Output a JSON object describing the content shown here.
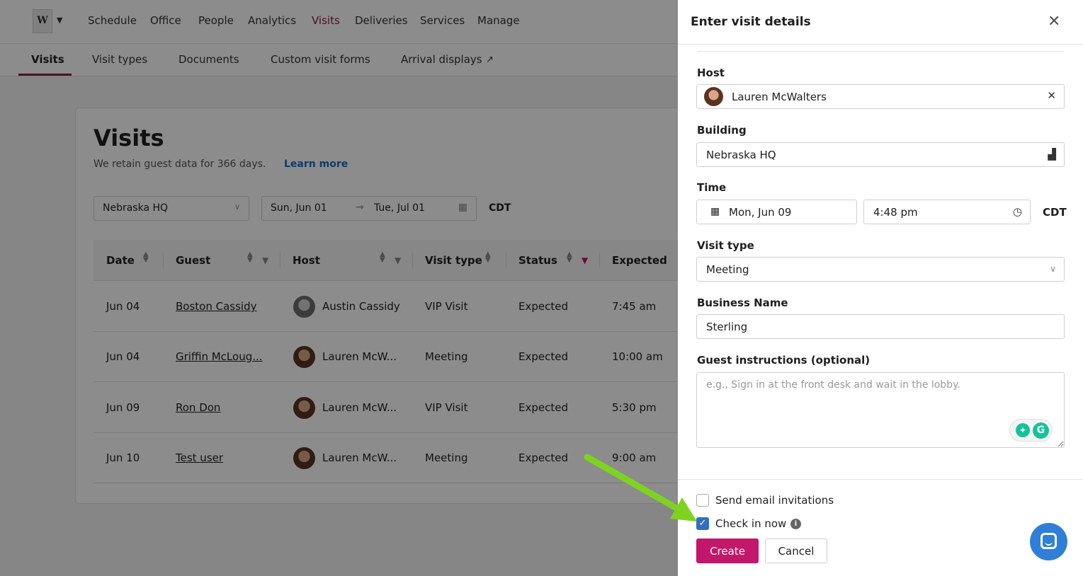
{
  "logo": {
    "letter": "W"
  },
  "nav": {
    "items": [
      "Schedule",
      "Office",
      "People",
      "Analytics",
      "Visits",
      "Deliveries",
      "Services",
      "Manage"
    ],
    "active": "Visits"
  },
  "subnav": {
    "items": [
      "Visits",
      "Visit types",
      "Documents",
      "Custom visit forms",
      "Arrival displays"
    ],
    "active": "Visits"
  },
  "visits": {
    "title": "Visits",
    "retain_text": "We retain guest data for 366 days.",
    "learn_more": "Learn more",
    "building_filter": "Nebraska HQ",
    "date_from": "Sun, Jun 01",
    "date_to": "Tue, Jul 01",
    "timezone": "CDT",
    "columns": [
      "Date",
      "Guest",
      "Host",
      "Visit type",
      "Status",
      "Expected"
    ],
    "rows": [
      {
        "date": "Jun 04",
        "guest": "Boston Cassidy",
        "host": "Austin Cassidy",
        "visit_type": "VIP Visit",
        "status": "Expected",
        "expected": "7:45 am"
      },
      {
        "date": "Jun 04",
        "guest": "Griffin McLoug...",
        "host": "Lauren McW...",
        "visit_type": "Meeting",
        "status": "Expected",
        "expected": "10:00 am"
      },
      {
        "date": "Jun 09",
        "guest": "Ron Don",
        "host": "Lauren McW...",
        "visit_type": "VIP Visit",
        "status": "Expected",
        "expected": "5:30 pm"
      },
      {
        "date": "Jun 10",
        "guest": "Test user",
        "host": "Lauren McW...",
        "visit_type": "Meeting",
        "status": "Expected",
        "expected": "9:00 am"
      }
    ]
  },
  "panel": {
    "title": "Enter visit details",
    "host_label": "Host",
    "host_value": "Lauren McWalters",
    "building_label": "Building",
    "building_value": "Nebraska HQ",
    "time_label": "Time",
    "date_value": "Mon, Jun 09",
    "time_value": "4:48 pm",
    "timezone": "CDT",
    "visit_type_label": "Visit type",
    "visit_type_value": "Meeting",
    "business_label": "Business Name",
    "business_value": "Sterling",
    "instructions_label": "Guest instructions (optional)",
    "instructions_placeholder": "e.g., Sign in at the front desk and wait in the lobby.",
    "send_email_label": "Send email invitations",
    "send_email_checked": false,
    "check_in_label": "Check in now",
    "check_in_checked": true,
    "create_label": "Create",
    "cancel_label": "Cancel"
  },
  "colors": {
    "accent": "#c2176b",
    "nav_active": "#8a1c4e",
    "checkbox": "#2f6fbf",
    "chat": "#2f7fd8",
    "annotation_arrow": "#7ed321"
  }
}
